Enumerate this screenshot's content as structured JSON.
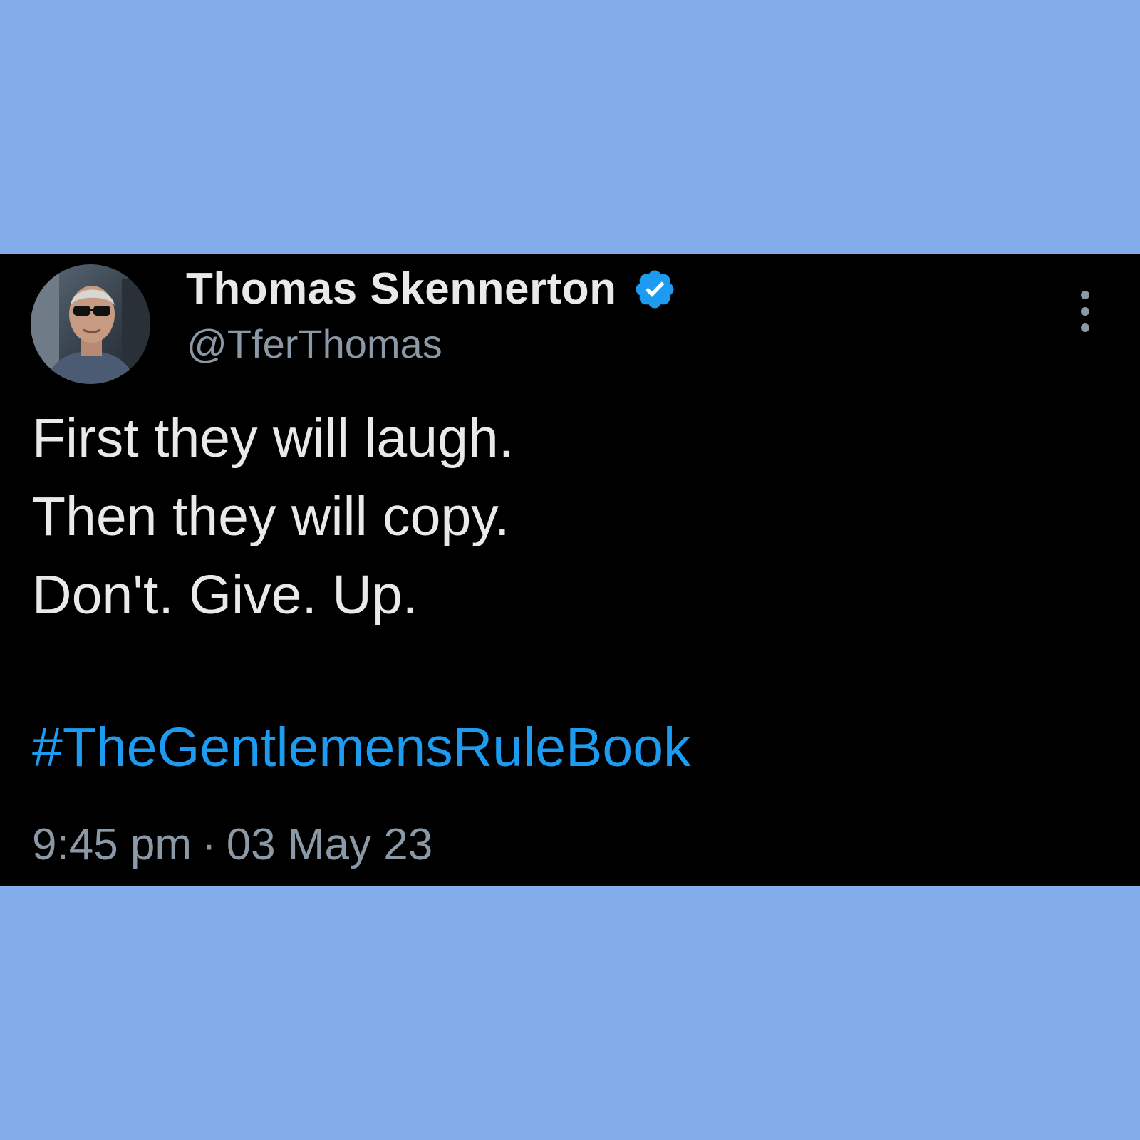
{
  "author": {
    "display_name": "Thomas Skennerton",
    "handle": "@TferThomas",
    "verified_icon": "verified-badge-icon",
    "avatar": "profile-photo"
  },
  "tweet": {
    "lines": [
      "First they will laugh.",
      "Then they will copy.",
      "Don't. Give. Up."
    ],
    "hashtag": "#TheGentlemensRuleBook"
  },
  "meta": {
    "time": "9:45 pm",
    "separator": "·",
    "date": "03 May 23"
  },
  "menu": {
    "icon": "more-vertical-icon"
  },
  "colors": {
    "background": "#82acea",
    "card": "#000000",
    "text": "#e7e9ea",
    "secondary_text": "#8b98a5",
    "accent": "#1d9bf0"
  }
}
